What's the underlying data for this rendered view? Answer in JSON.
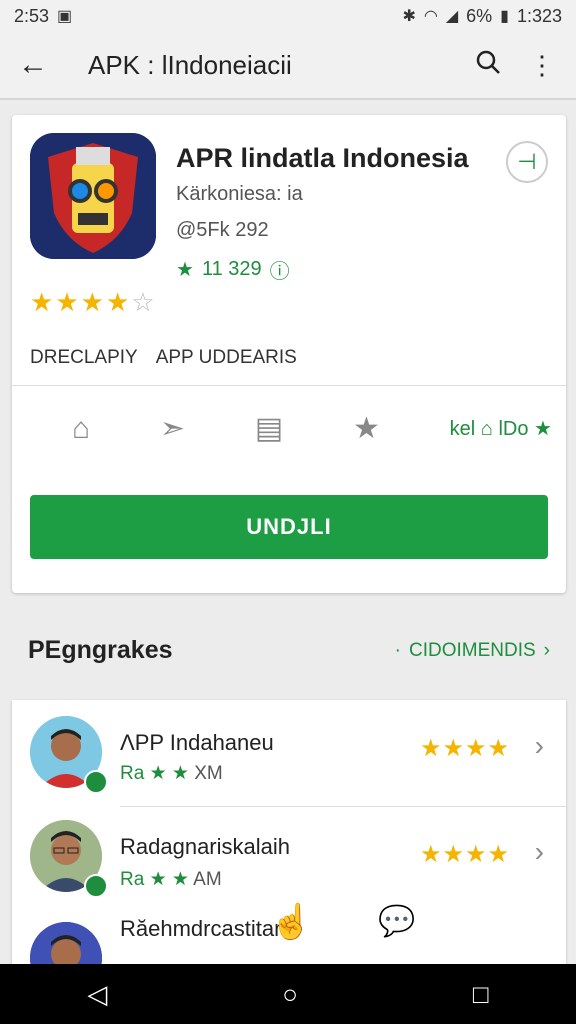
{
  "status": {
    "time": "2:53",
    "battery": "6%",
    "clock_right": "1:323"
  },
  "appbar": {
    "title": "APK : lIndoneiacii"
  },
  "app": {
    "title": "APR lindatla Indonesia",
    "developer": "Kärkoniesa: ia",
    "size": "@5Fk 292",
    "rating_count": "11 329",
    "stars": 3.5,
    "tabs": [
      "DRECLAPIY",
      "APP UDDEARIS"
    ],
    "badge_text": "kel",
    "badge_text2": "lDo",
    "install_label": "UNDJLI"
  },
  "section": {
    "title": "PEgngrakes",
    "link": "CIDOIMENDIS"
  },
  "list": [
    {
      "name": "ΛPP Indahaneu",
      "sub_prefix": "Ra",
      "sub_suffix": "ΧM",
      "stars": 4
    },
    {
      "name": "Radagnariskalaih",
      "sub_prefix": "Ra",
      "sub_suffix": "AM",
      "stars": 4
    },
    {
      "name": "Răehmdrcastitam",
      "sub_prefix": "",
      "sub_suffix": "",
      "stars": 0
    }
  ]
}
